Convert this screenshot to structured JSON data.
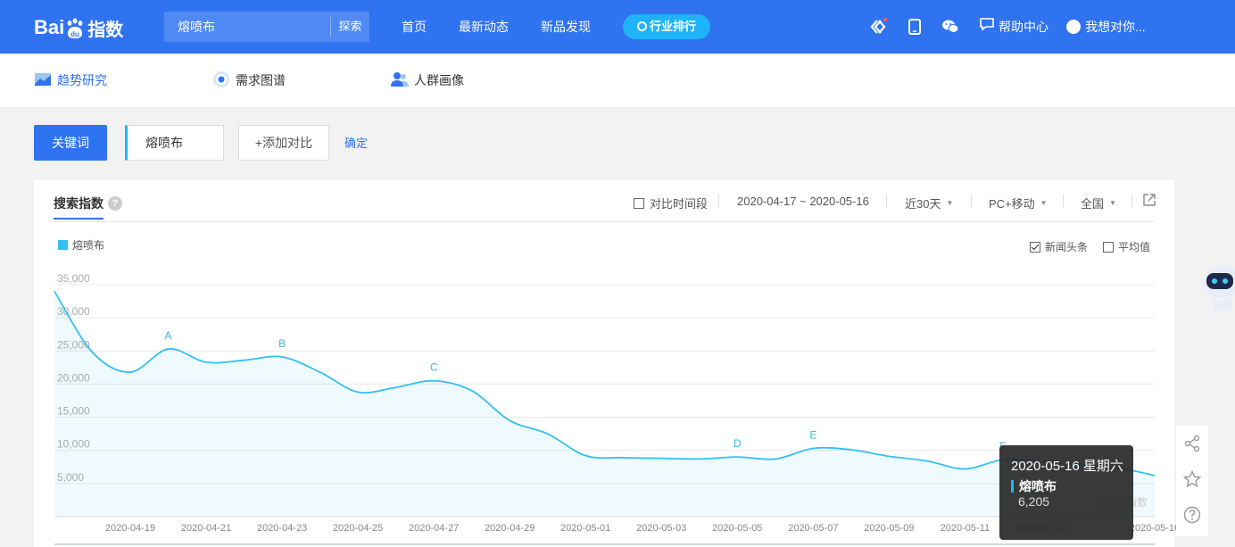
{
  "header": {
    "logo_text": "Bai",
    "logo_text_2": "指数",
    "search_value": "熔喷布",
    "search_button": "探索",
    "nav": [
      "首页",
      "最新动态",
      "新品发现"
    ],
    "rank_button": "行业排行",
    "help": "帮助中心",
    "user": "我想对你..."
  },
  "subnav": {
    "items": [
      "趋势研究",
      "需求图谱",
      "人群画像"
    ]
  },
  "keyword_bar": {
    "keyword_button": "关键词",
    "keyword": "熔喷布",
    "add_compare": "+添加对比",
    "confirm": "确定"
  },
  "panel": {
    "title": "搜索指数",
    "help_mark": "?",
    "compare_period": "对比时间段",
    "date_range": "2020-04-17 ~ 2020-05-16",
    "period": "近30天",
    "device": "PC+移动",
    "region": "全国",
    "news_toggle": "新闻头条",
    "avg_toggle": "平均值",
    "news_checked": true,
    "avg_checked": false
  },
  "tooltip": {
    "date": "2020-05-16 星期六",
    "series": "熔喷布",
    "value": "6,205"
  },
  "watermark": "@百度指数",
  "colors": {
    "brand": "#2f73f0",
    "series": "#33c0f0",
    "rank": "#1fb4f7"
  },
  "chart_data": {
    "type": "area",
    "series": [
      {
        "name": "熔喷布",
        "values": [
          34000,
          24800,
          21800,
          25300,
          23300,
          23600,
          24100,
          21800,
          18800,
          19500,
          20500,
          19000,
          14500,
          12500,
          9200,
          8900,
          8800,
          8700,
          9000,
          8700,
          10300,
          10100,
          9100,
          8400,
          7200,
          8600,
          8300,
          7800,
          7400,
          6205
        ]
      }
    ],
    "x": [
      "2020-04-17",
      "2020-04-18",
      "2020-04-19",
      "2020-04-20",
      "2020-04-21",
      "2020-04-22",
      "2020-04-23",
      "2020-04-24",
      "2020-04-25",
      "2020-04-26",
      "2020-04-27",
      "2020-04-28",
      "2020-04-29",
      "2020-04-30",
      "2020-05-01",
      "2020-05-02",
      "2020-05-03",
      "2020-05-04",
      "2020-05-05",
      "2020-05-06",
      "2020-05-07",
      "2020-05-08",
      "2020-05-09",
      "2020-05-10",
      "2020-05-11",
      "2020-05-12",
      "2020-05-13",
      "2020-05-14",
      "2020-05-15",
      "2020-05-16"
    ],
    "x_tick_labels": [
      "2020-04-19",
      "2020-04-21",
      "2020-04-23",
      "2020-04-25",
      "2020-04-27",
      "2020-04-29",
      "2020-05-01",
      "2020-05-03",
      "2020-05-05",
      "2020-05-07",
      "2020-05-09",
      "2020-05-11",
      "2020-05-13",
      "2020-05-16"
    ],
    "y_ticks": [
      5000,
      10000,
      15000,
      20000,
      25000,
      30000,
      35000
    ],
    "y_tick_labels": [
      "5,000",
      "10,000",
      "15,000",
      "20,000",
      "25,000",
      "30,000",
      "35,000"
    ],
    "ylim": [
      0,
      35000
    ],
    "grid": true,
    "annotations": [
      {
        "label": "A",
        "x": "2020-04-20",
        "y": 25300
      },
      {
        "label": "B",
        "x": "2020-04-23",
        "y": 24100
      },
      {
        "label": "C",
        "x": "2020-04-27",
        "y": 20500
      },
      {
        "label": "D",
        "x": "2020-05-05",
        "y": 9000
      },
      {
        "label": "E",
        "x": "2020-05-07",
        "y": 10300
      },
      {
        "label": "F",
        "x": "2020-05-12",
        "y": 8600
      }
    ]
  }
}
